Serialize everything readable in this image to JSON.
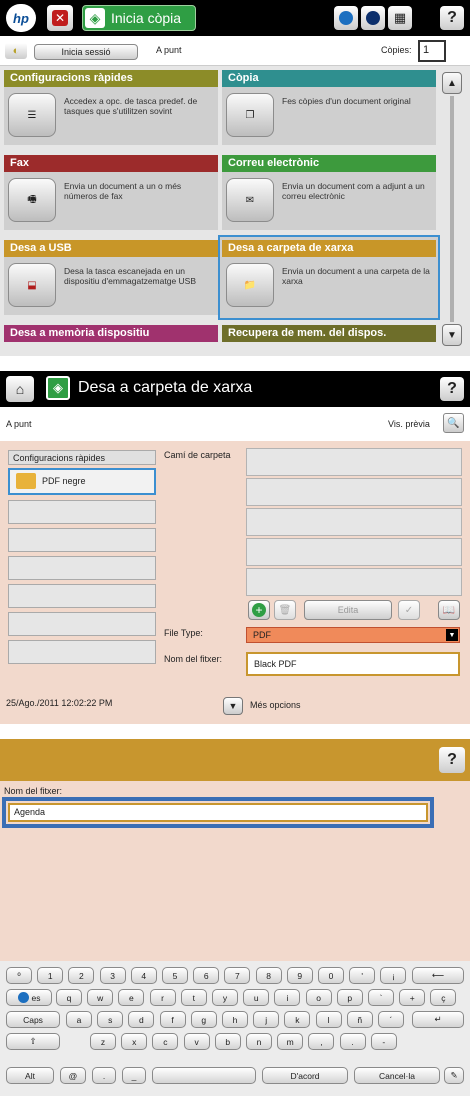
{
  "screen1": {
    "title": "Inicia còpia",
    "signin_label": "Inicia sessió",
    "status": "A punt",
    "copies_label": "Còpies:",
    "copies_value": "1",
    "tiles": [
      {
        "title": "Configuracions ràpides",
        "desc": "Accedex a opc. de tasca predef. de tasques que s'utilitzen sovint",
        "color": "#8c8c28"
      },
      {
        "title": "Còpia",
        "desc": "Fes còpies d'un document original",
        "color": "#2f8f8f"
      },
      {
        "title": "Fax",
        "desc": "Envia un document a un o més números de fax",
        "color": "#9c2b2b"
      },
      {
        "title": "Correu electrònic",
        "desc": "Envia un document com a adjunt a un correu electrònic",
        "color": "#3d9a3d"
      },
      {
        "title": "Desa a USB",
        "desc": "Desa la tasca escanejada en un dispositiu d'emmagatzematge USB",
        "color": "#c89628"
      },
      {
        "title": "Desa a carpeta de xarxa",
        "desc": "Envia un document a una carpeta de la xarxa",
        "color": "#c89628"
      },
      {
        "title": "Desa a memòria dispositiu",
        "color": "#a0326e"
      },
      {
        "title": "Recupera de mem. del dispos.",
        "color": "#6e6e2a"
      }
    ]
  },
  "screen2": {
    "title": "Desa a carpeta de xarxa",
    "status": "A punt",
    "preview_label": "Vis. prèvia",
    "quick_sets_header": "Configuracions ràpides",
    "quick_set_item": "PDF negre",
    "folder_path_label": "Camí de carpeta",
    "edit_label": "Edita",
    "file_type_label": "File Type:",
    "file_type_value": "PDF",
    "file_name_label": "Nom del fitxer:",
    "file_name_value": "Black PDF",
    "datetime": "25/Ago./2011 12:02:22 PM",
    "more_options": "Més opcions"
  },
  "screen3": {
    "field_label": "Nom del fitxer:",
    "field_value": "Agenda",
    "keyboard": {
      "row1": [
        "º",
        "1",
        "2",
        "3",
        "4",
        "5",
        "6",
        "7",
        "8",
        "9",
        "0",
        "'",
        "¡"
      ],
      "row2": [
        "es",
        "q",
        "w",
        "e",
        "r",
        "t",
        "y",
        "u",
        "i",
        "o",
        "p",
        "`",
        "+",
        "ç"
      ],
      "row3": [
        "Caps",
        "a",
        "s",
        "d",
        "f",
        "g",
        "h",
        "j",
        "k",
        "l",
        "ñ",
        "´"
      ],
      "row4": [
        "z",
        "x",
        "c",
        "v",
        "b",
        "n",
        "m",
        ",",
        ".",
        "-"
      ],
      "row5": [
        "Alt",
        "@",
        ".",
        "_"
      ],
      "ok_label": "D'acord",
      "cancel_label": "Cancel·la"
    }
  },
  "colors": {
    "ribbon_gold": "#c8962e",
    "panel_bg": "#f2d9cc",
    "highlight_blue": "#3c8fd0"
  }
}
